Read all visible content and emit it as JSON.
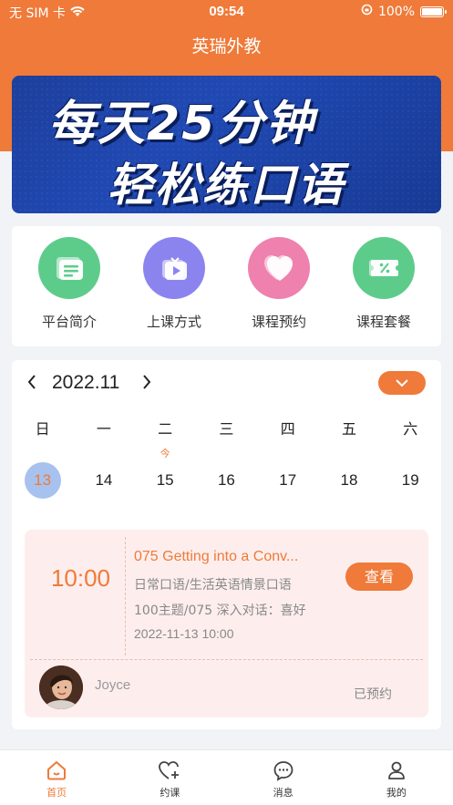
{
  "status_bar": {
    "carrier": "无 SIM 卡",
    "time": "09:54",
    "battery": "100%"
  },
  "header": {
    "title": "英瑞外教"
  },
  "banner": {
    "line1": "每天25分钟",
    "line2": "轻松练口语"
  },
  "quick_actions": [
    {
      "label": "平台简介",
      "icon": "document-icon",
      "color": "#5dcc8b"
    },
    {
      "label": "上课方式",
      "icon": "video-play-icon",
      "color": "#8c84ee"
    },
    {
      "label": "课程预约",
      "icon": "heart-icon",
      "color": "#ef81ae"
    },
    {
      "label": "课程套餐",
      "icon": "coupon-icon",
      "color": "#5dcc8b"
    }
  ],
  "calendar": {
    "month": "2022.11",
    "prev_icon": "chevron-left-icon",
    "next_icon": "chevron-right-icon",
    "toggle_icon": "chevron-down-icon",
    "weekdays": [
      "日",
      "一",
      "二",
      "三",
      "四",
      "五",
      "六"
    ],
    "days": [
      "13",
      "14",
      "15",
      "16",
      "17",
      "18",
      "19"
    ],
    "today_mark": "今",
    "selected_day": "13"
  },
  "lesson": {
    "time": "10:00",
    "title": "075 Getting into a Conv...",
    "category": "日常口语/生活英语情景口语",
    "topic": "100主题/075 深入对话：喜好",
    "datetime": "2022-11-13 10:00",
    "view_button": "查看",
    "teacher": "Joyce",
    "status": "已预约"
  },
  "tabbar": {
    "tabs": [
      {
        "label": "首页",
        "icon": "home-icon",
        "active": true
      },
      {
        "label": "约课",
        "icon": "heart-plus-icon",
        "active": false
      },
      {
        "label": "消息",
        "icon": "message-icon",
        "active": false
      },
      {
        "label": "我的",
        "icon": "user-icon",
        "active": false
      }
    ]
  },
  "colors": {
    "accent": "#ef7a39",
    "lesson_bg": "#fdeeed",
    "page_bg": "#f2f3f7"
  }
}
